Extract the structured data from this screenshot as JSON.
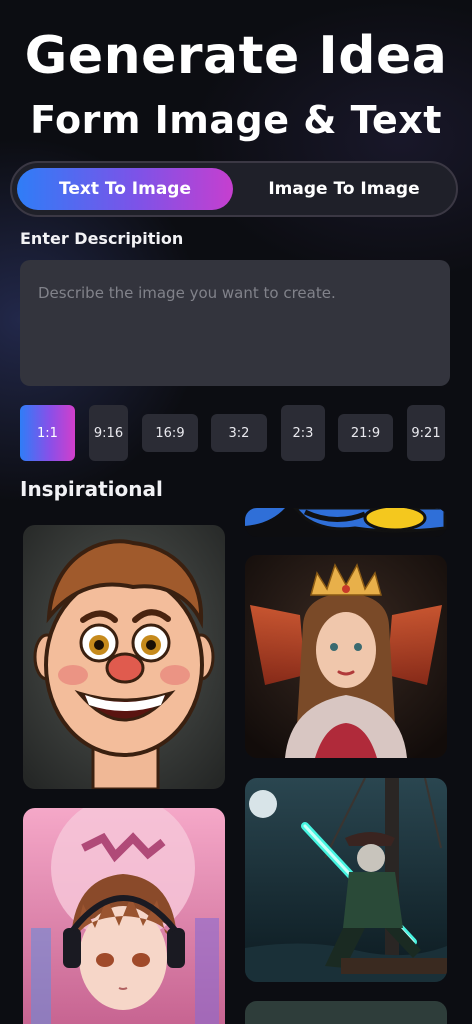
{
  "header": {
    "line1": "Generate Idea",
    "line2": "Form Image & Text"
  },
  "mode_tabs": [
    {
      "label": "Text To Image",
      "active": true
    },
    {
      "label": "Image To Image",
      "active": false
    }
  ],
  "description": {
    "label": "Enter Descripition",
    "placeholder": "Describe the image you want to create.",
    "value": ""
  },
  "aspect_ratios": {
    "options": [
      "1:1",
      "9:16",
      "16:9",
      "3:2",
      "2:3",
      "21:9",
      "9:21"
    ],
    "selected": "1:1"
  },
  "inspirational": {
    "label": "Inspirational",
    "items": [
      {
        "name": "cartoon-boy-image"
      },
      {
        "name": "cartoon-bird-image"
      },
      {
        "name": "fairy-princess-image"
      },
      {
        "name": "anime-boy-headphones-image"
      },
      {
        "name": "pirate-skeleton-sword-image"
      },
      {
        "name": "partial-image"
      }
    ]
  },
  "colors": {
    "accent_start": "#2f7df7",
    "accent_end": "#c63fcf",
    "background": "#0c0d12",
    "input_bg": "#33343d",
    "chip_bg": "#2b2c35"
  }
}
